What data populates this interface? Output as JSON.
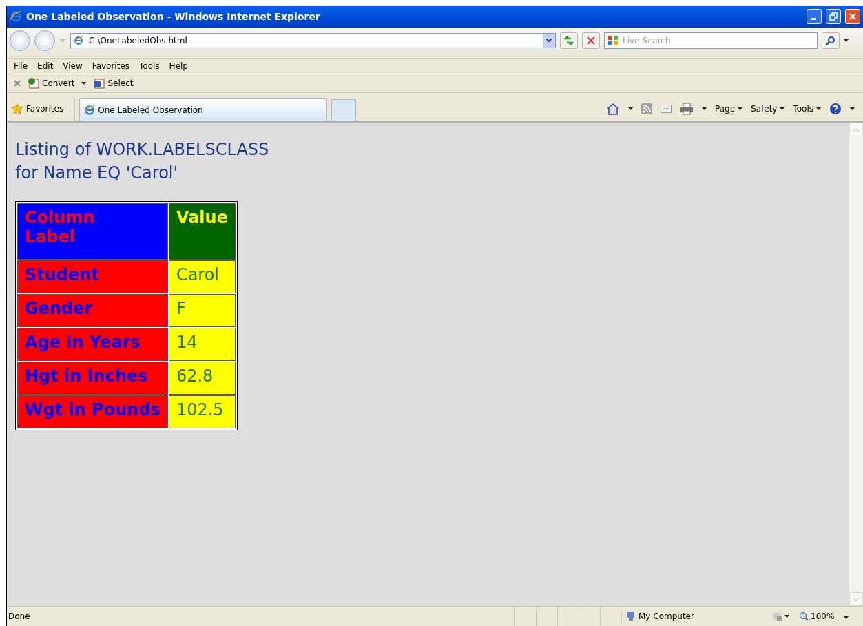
{
  "window": {
    "title": "One Labeled Observation - Windows Internet Explorer"
  },
  "address": {
    "value": "C:\\OneLabeledObs.html"
  },
  "search": {
    "placeholder": "Live Search"
  },
  "menu": [
    "File",
    "Edit",
    "View",
    "Favorites",
    "Tools",
    "Help"
  ],
  "toolbar": [
    "Convert",
    "Select"
  ],
  "favorites": "Favorites",
  "tabs": [
    {
      "label": "One Labeled Observation",
      "selected": true
    }
  ],
  "command_bar": [
    "Page",
    "Safety",
    "Tools"
  ],
  "page": {
    "heading": [
      "Listing of WORK.LABELSCLASS",
      "for Name EQ 'Carol'"
    ],
    "table": {
      "columns": [
        "Column Label",
        "Value"
      ],
      "rows": [
        {
          "label": "Student",
          "value": "Carol"
        },
        {
          "label": "Gender",
          "value": "F"
        },
        {
          "label": "Age in Years",
          "value": "14"
        },
        {
          "label": "Hgt in Inches",
          "value": "62.8"
        },
        {
          "label": "Wgt in Pounds",
          "value": "102.5"
        }
      ]
    }
  },
  "status_bar": {
    "text": "Done",
    "zone": "My Computer",
    "zoom": "100%"
  }
}
